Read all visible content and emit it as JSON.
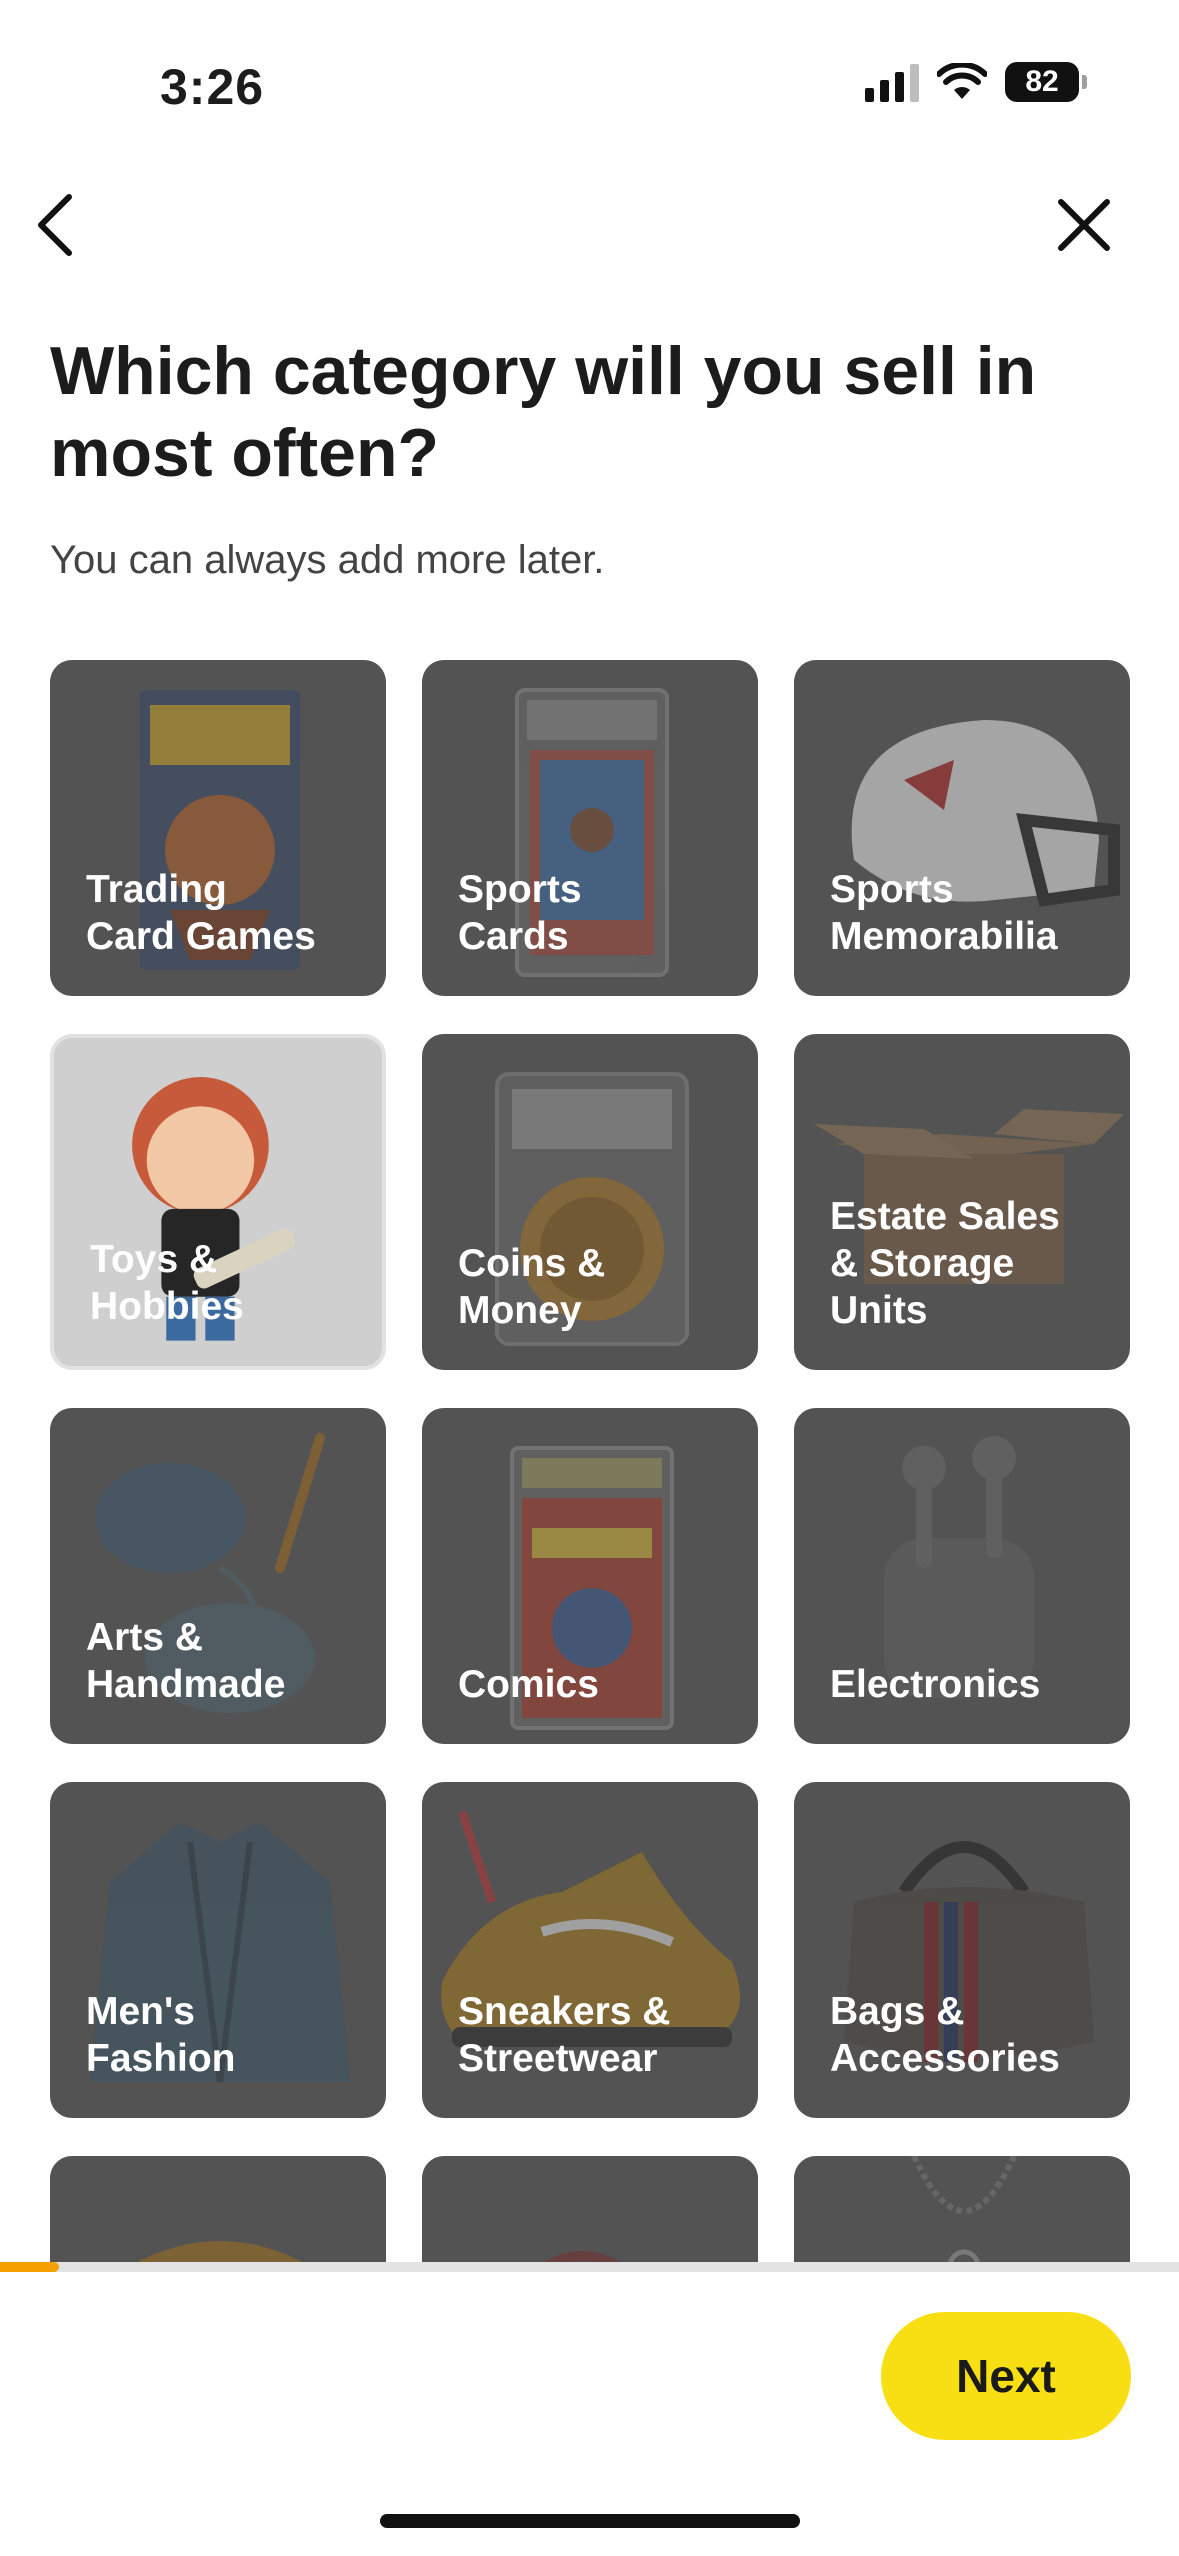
{
  "status_bar": {
    "time": "3:26",
    "battery": "82"
  },
  "header": {
    "title": "Which category will you sell in most often?",
    "subtitle": "You can always add more later."
  },
  "categories": [
    {
      "label": "Trading\nCard Games",
      "icon": "pokemon-pack-image",
      "selected": false
    },
    {
      "label": "Sports\nCards",
      "icon": "graded-sports-card-image",
      "selected": false
    },
    {
      "label": "Sports\nMemorabilia",
      "icon": "football-helmet-image",
      "selected": false
    },
    {
      "label": "Toys &\nHobbies",
      "icon": "vinyl-figure-image",
      "selected": true
    },
    {
      "label": "Coins &\nMoney",
      "icon": "graded-coin-image",
      "selected": false
    },
    {
      "label": "Estate Sales\n& Storage\nUnits",
      "icon": "cardboard-box-image",
      "selected": false
    },
    {
      "label": "Arts &\nHandmade",
      "icon": "yarn-crochet-image",
      "selected": false
    },
    {
      "label": "Comics",
      "icon": "graded-comic-image",
      "selected": false
    },
    {
      "label": "Electronics",
      "icon": "earbuds-image",
      "selected": false
    },
    {
      "label": "Men's\nFashion",
      "icon": "jacket-image",
      "selected": false
    },
    {
      "label": "Sneakers &\nStreetwear",
      "icon": "sneaker-image",
      "selected": false
    },
    {
      "label": "Bags &\nAccessories",
      "icon": "handbag-image",
      "selected": false
    },
    {
      "label": "",
      "icon": "sweater-image",
      "selected": false
    },
    {
      "label": "",
      "icon": "cosmetics-image",
      "selected": false
    },
    {
      "label": "",
      "icon": "necklace-image",
      "selected": false
    }
  ],
  "progress": {
    "fraction": 0.05
  },
  "footer": {
    "next_label": "Next"
  },
  "colors": {
    "accent": "#f7df14",
    "progress": "#f5a000",
    "tile": "#535353",
    "tile_selected": "#cfcfcf"
  }
}
